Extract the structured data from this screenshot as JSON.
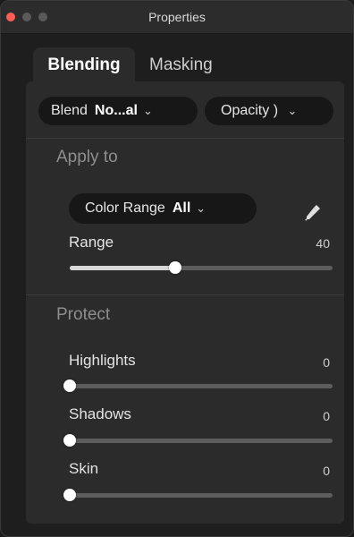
{
  "window": {
    "title": "Properties"
  },
  "tabs": [
    {
      "label": "Blending",
      "active": true
    },
    {
      "label": "Masking",
      "active": false
    }
  ],
  "blend": {
    "label": "Blend",
    "value": "No...al"
  },
  "opacity": {
    "label": "Opacity",
    "value": ")"
  },
  "apply_to": {
    "heading": "Apply to",
    "color_range_label": "Color Range",
    "color_range_value": "All",
    "eyedropper_icon": "eyedropper-icon",
    "range": {
      "label": "Range",
      "value": "40",
      "fraction": 0.4
    }
  },
  "protect": {
    "heading": "Protect",
    "sliders": [
      {
        "label": "Highlights",
        "value": "0",
        "fraction": 0
      },
      {
        "label": "Shadows",
        "value": "0",
        "fraction": 0
      },
      {
        "label": "Skin",
        "value": "0",
        "fraction": 0
      }
    ]
  },
  "colors": {
    "close_button": "#ff5f57",
    "panel_bg": "#2b2b2b",
    "pill_bg": "#171717"
  }
}
